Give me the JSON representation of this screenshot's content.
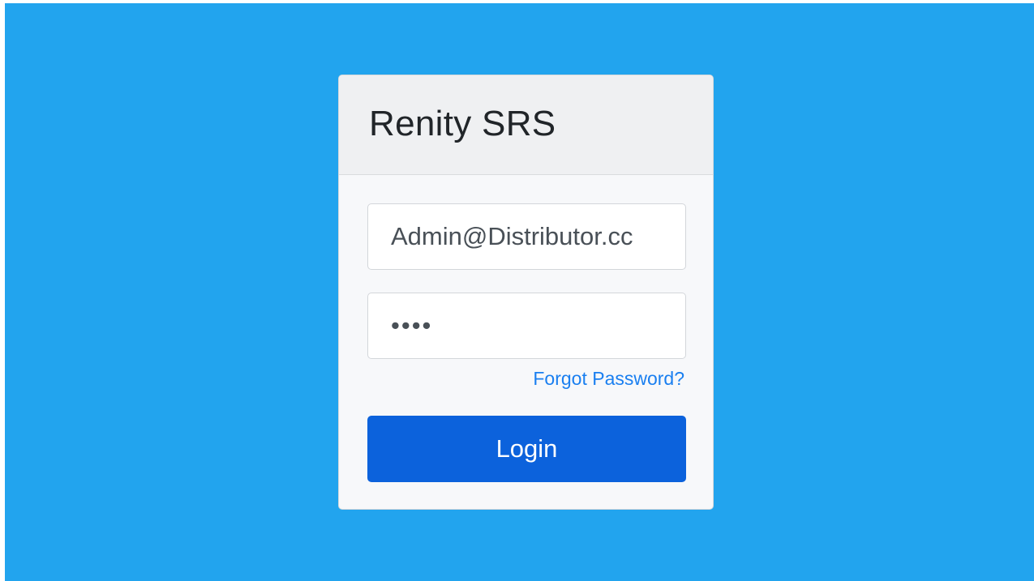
{
  "colors": {
    "background": "#22a4ee",
    "card": "#f7f8fa",
    "card_header": "#eff0f2",
    "link": "#1a7ff0",
    "primary_button": "#0c62dc"
  },
  "login": {
    "title": "Renity SRS",
    "email": {
      "value": "Admin@Distributor.cc",
      "placeholder": ""
    },
    "password": {
      "value": "abcd",
      "placeholder": ""
    },
    "forgot_password_label": "Forgot Password?",
    "login_button_label": "Login"
  }
}
